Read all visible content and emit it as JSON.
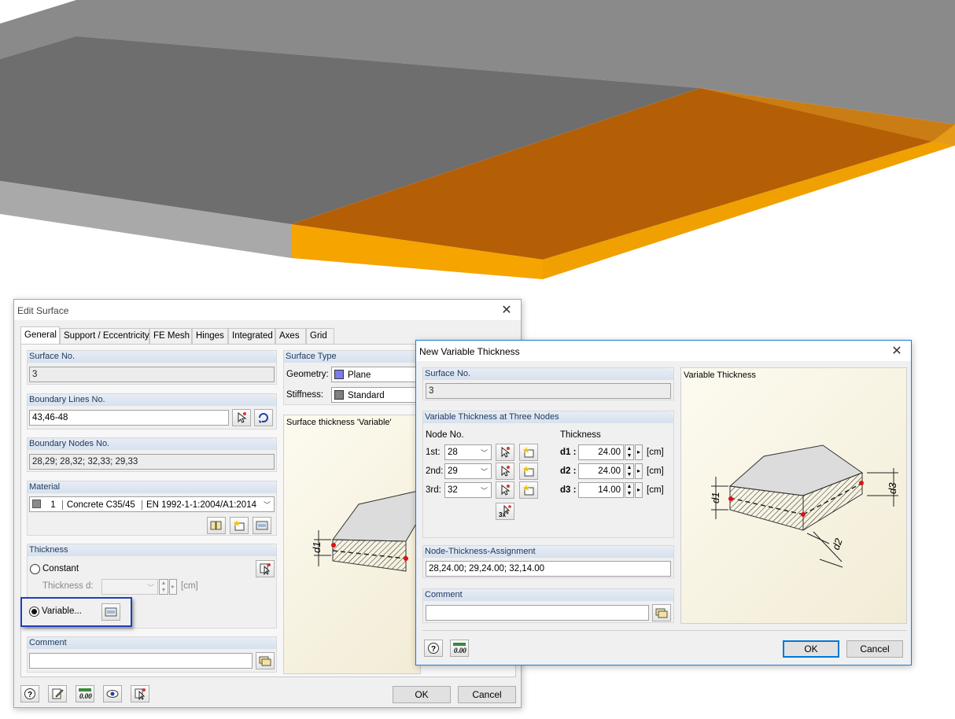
{
  "edit_surface": {
    "title": "Edit Surface",
    "close_glyph": "✕",
    "tabs": [
      "General",
      "Support / Eccentricity",
      "FE Mesh",
      "Hinges",
      "Integrated",
      "Axes",
      "Grid"
    ],
    "surface_no": {
      "label": "Surface No.",
      "value": "3"
    },
    "boundary_lines": {
      "label": "Boundary Lines No.",
      "value": "43,46-48"
    },
    "boundary_nodes": {
      "label": "Boundary Nodes No.",
      "value": "28,29; 28,32; 32,33; 29,33"
    },
    "material": {
      "label": "Material",
      "number": "1",
      "name": "Concrete C35/45",
      "standard": "EN 1992-1-1:2004/A1:2014",
      "swatch": "#8c8c8c"
    },
    "thickness": {
      "label": "Thickness",
      "constant_label": "Constant",
      "thickness_d_label": "Thickness d:",
      "unit": "[cm]",
      "variable_label": "Variable...",
      "selected": "variable"
    },
    "comment": {
      "label": "Comment",
      "value": ""
    },
    "surface_type": {
      "label": "Surface Type",
      "geometry_label": "Geometry:",
      "geometry_value": "Plane",
      "geometry_color": "#7b7bf0",
      "stiffness_label": "Stiffness:",
      "stiffness_value": "Standard",
      "stiffness_color": "#808080"
    },
    "preview_label": "Surface thickness 'Variable'",
    "diagram_labels": {
      "d1": "d1"
    },
    "ok_label": "OK",
    "cancel_label": "Cancel"
  },
  "variable_thickness": {
    "title": "New Variable Thickness",
    "close_glyph": "✕",
    "surface_no": {
      "label": "Surface No.",
      "value": "3"
    },
    "three_nodes": {
      "label": "Variable Thickness at Three Nodes",
      "node_no_label": "Node No.",
      "thickness_label": "Thickness",
      "unit": "[cm]",
      "rows": [
        {
          "ordinal": "1st:",
          "node": "28",
          "d_label": "d1 :",
          "thickness": "24.00"
        },
        {
          "ordinal": "2nd:",
          "node": "29",
          "d_label": "d2 :",
          "thickness": "24.00"
        },
        {
          "ordinal": "3rd:",
          "node": "32",
          "d_label": "d3 :",
          "thickness": "14.00"
        }
      ],
      "pick_three_label": "3x"
    },
    "assignment": {
      "label": "Node-Thickness-Assignment",
      "value": "28,24.00; 29,24.00; 32,14.00"
    },
    "comment": {
      "label": "Comment",
      "value": ""
    },
    "preview_label": "Variable Thickness",
    "diagram_labels": {
      "d1": "d1",
      "d2": "d2",
      "d3": "d3"
    },
    "ok_label": "OK",
    "cancel_label": "Cancel"
  },
  "icons": [
    "help-icon",
    "units-icon",
    "pick-icon",
    "new-icon",
    "edit-icon",
    "library-icon",
    "view-icon",
    "show-icon"
  ],
  "colors": {
    "slab_orange": "#f5a000",
    "slab_grey": "#6e6e6e",
    "accent_blue": "#1f3fbf"
  }
}
